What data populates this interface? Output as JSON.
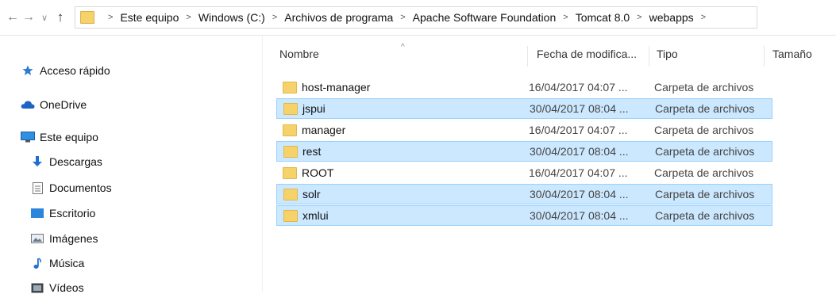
{
  "address": {
    "back_icon": "back-arrow-icon",
    "forward_icon": "forward-arrow-icon",
    "recent_icon": "chevron-down-icon",
    "up_icon": "up-arrow-icon",
    "breadcrumbs": [
      "Este equipo",
      "Windows (C:)",
      "Archivos de programa",
      "Apache Software Foundation",
      "Tomcat 8.0",
      "webapps"
    ]
  },
  "nav": {
    "quick_access": "Acceso rápido",
    "onedrive": "OneDrive",
    "this_pc": "Este equipo",
    "downloads": "Descargas",
    "documents": "Documentos",
    "desktop": "Escritorio",
    "pictures": "Imágenes",
    "music": "Música",
    "videos": "Vídeos"
  },
  "columns": {
    "name": "Nombre",
    "date": "Fecha de modifica...",
    "type": "Tipo",
    "size": "Tamaño"
  },
  "files": [
    {
      "name": "host-manager",
      "date": "16/04/2017 04:07 ...",
      "type": "Carpeta de archivos",
      "selected": false
    },
    {
      "name": "jspui",
      "date": "30/04/2017 08:04 ...",
      "type": "Carpeta de archivos",
      "selected": true
    },
    {
      "name": "manager",
      "date": "16/04/2017 04:07 ...",
      "type": "Carpeta de archivos",
      "selected": false
    },
    {
      "name": "rest",
      "date": "30/04/2017 08:04 ...",
      "type": "Carpeta de archivos",
      "selected": true
    },
    {
      "name": "ROOT",
      "date": "16/04/2017 04:07 ...",
      "type": "Carpeta de archivos",
      "selected": false
    },
    {
      "name": "solr",
      "date": "30/04/2017 08:04 ...",
      "type": "Carpeta de archivos",
      "selected": true
    },
    {
      "name": "xmlui",
      "date": "30/04/2017 08:04 ...",
      "type": "Carpeta de archivos",
      "selected": true
    }
  ],
  "colors": {
    "selection_bg": "#cce8ff",
    "selection_border": "#99d1ff",
    "folder": "#f6d36a"
  }
}
